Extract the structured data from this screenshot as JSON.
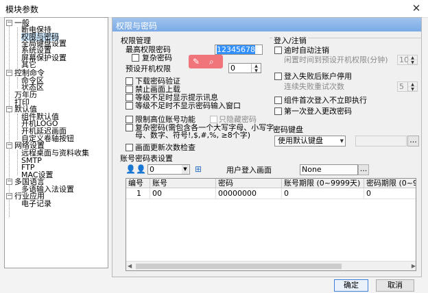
{
  "window": {
    "title": "模块参数"
  },
  "tree": {
    "groups": [
      {
        "label": "一般",
        "children": [
          "断电保持",
          "权限与密码",
          "全局键盘设置",
          "系统设置",
          "屏幕保护设置",
          "其它"
        ]
      },
      {
        "label": "控制命令",
        "children": [
          "命令区",
          "状态区"
        ]
      },
      {
        "label": "万年历",
        "children": []
      },
      {
        "label": "打印",
        "children": []
      },
      {
        "label": "默认值",
        "children": [
          "组件默认值",
          "开机LOGO",
          "开机延迟画面",
          "自定义卷轴按钮"
        ]
      },
      {
        "label": "网络设置",
        "children": [
          "远程桌面与资料收集",
          "SMTP",
          "FTP",
          "MAC设置"
        ]
      },
      {
        "label": "多国语言",
        "children": [
          "多语输入法设置"
        ]
      },
      {
        "label": "行业应用",
        "children": [
          "电子记录"
        ]
      }
    ]
  },
  "panel": {
    "header": "权限与密码"
  },
  "auth": {
    "group_title": "权限管理",
    "max_password_label": "最高权限密码",
    "max_password_value": "12345678",
    "complex_password_label": "复杂密码",
    "preset_boot_label": "预设开机权限",
    "preset_boot_value": "0",
    "options": [
      "下载密码验证",
      "禁止画面上载",
      "等级不足时显示提示讯息",
      "等级不足时不显示密码输入窗口"
    ],
    "limit_account_label": "限制高位账号功能",
    "hide_password_label": "只隐藏密码",
    "complex_rule_line1": "复杂密码(需包含各一个大写字母、小写字",
    "complex_rule_line2": "母、数字、符号!,$,#,%, ≥8个字)",
    "screen_update_label": "画面更新次数检查"
  },
  "login": {
    "group_title": "登入/注销",
    "timeout_logout_label": "逾时自动注销",
    "timeout_hint": "闲置时间到预设开机权限(分钟)",
    "timeout_value": "10",
    "fail_stop_label": "登入失败后账户停用",
    "fail_hint": "连续失败重试次数",
    "fail_value": "5",
    "first_login_no_exec_label": "组件首次登入不立即执行",
    "first_login_change_label": "第一次登入更改密码"
  },
  "keyboard": {
    "group_title": "密码键盘",
    "select_value": "使用默认键盘",
    "browse_label": "..."
  },
  "account_table": {
    "group_title": "账号密码表设置",
    "combo_value": "0",
    "user_login_label": "用户登入画面",
    "user_login_value": "None",
    "browse_label": "...",
    "columns": [
      "编号",
      "账号",
      "密码",
      "账号期限 (0~9999天)",
      "密码期限 (0~9999"
    ],
    "rows": [
      [
        "1",
        "00",
        "00000000",
        "0",
        "0"
      ]
    ]
  },
  "footer": {
    "ok_label": "确定",
    "cancel_label": "取消"
  },
  "colors": {
    "header_accent": "#7aaae6",
    "float_badge": "#f0757a",
    "selection": "#3390ff"
  }
}
